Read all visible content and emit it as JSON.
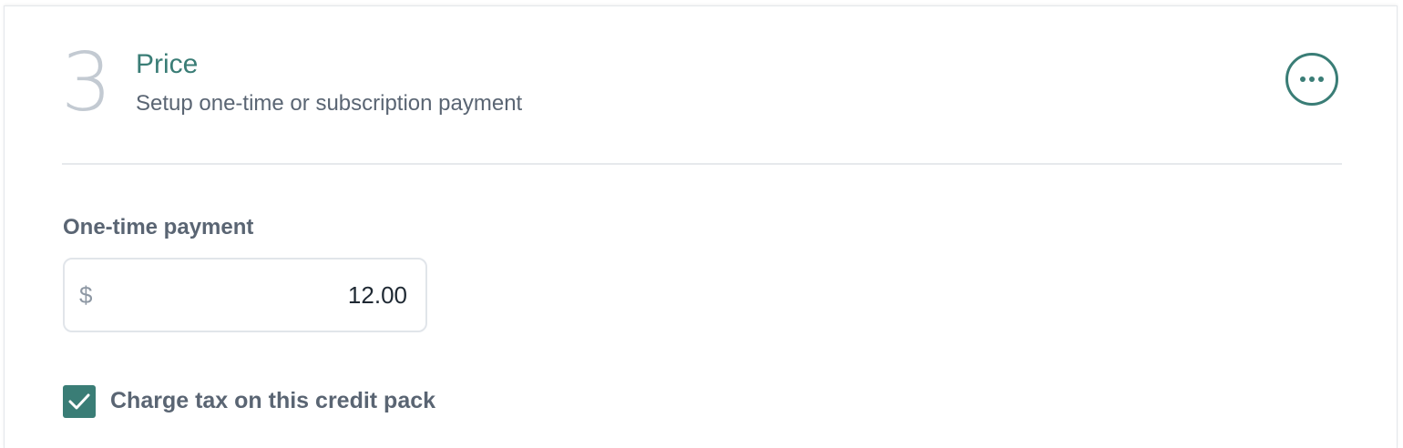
{
  "section": {
    "step_number": "3",
    "title": "Price",
    "subtitle": "Setup one-time or subscription payment",
    "more_icon": "ellipsis-horizontal-icon"
  },
  "payment": {
    "label": "One-time payment",
    "currency_symbol": "$",
    "amount": "12.00"
  },
  "tax": {
    "checked": true,
    "label": "Charge tax on this credit pack",
    "check_icon": "checkmark-icon"
  },
  "colors": {
    "accent": "#3a7d76",
    "muted_number": "#c3cad2",
    "text": "#5a6573"
  }
}
